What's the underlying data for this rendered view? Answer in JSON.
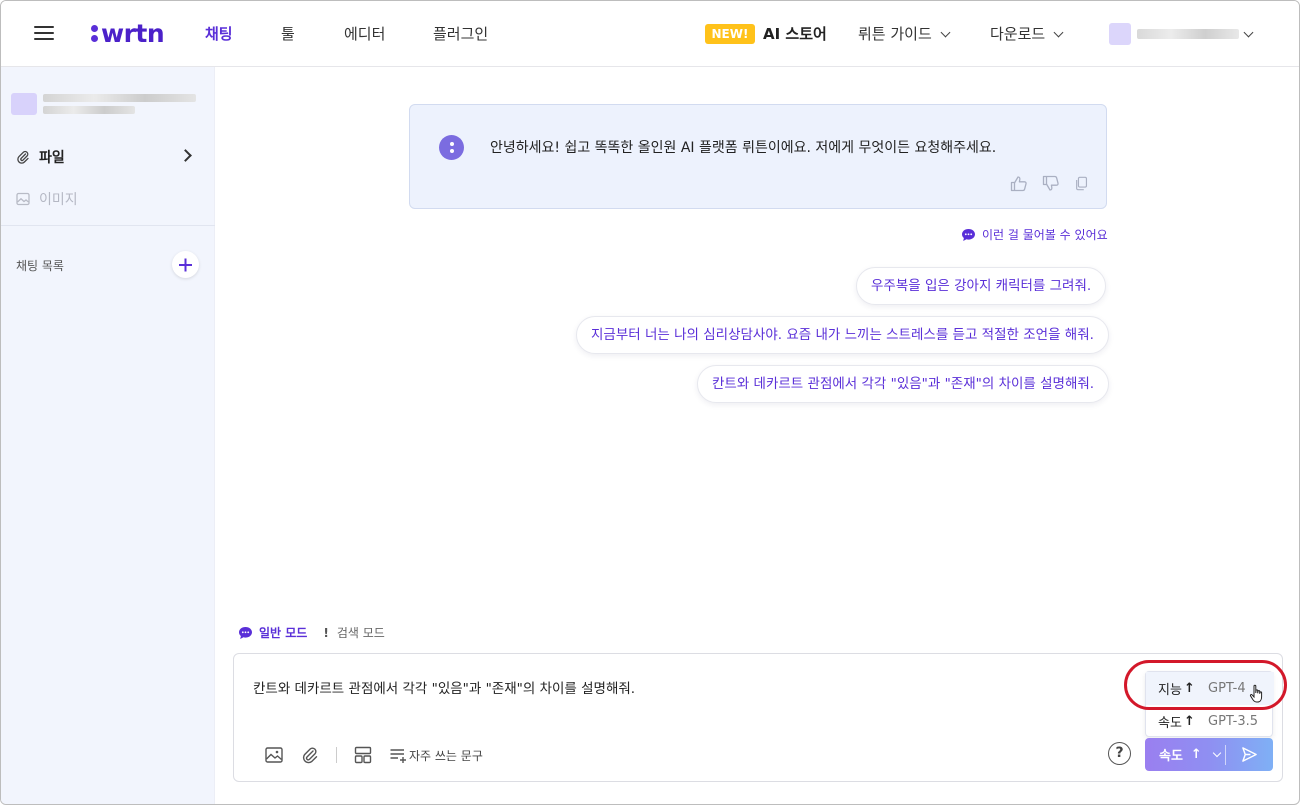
{
  "header": {
    "logo_text": "wrtn",
    "nav": [
      "채팅",
      "툴",
      "에디터",
      "플러그인"
    ],
    "new_badge": "NEW!",
    "store_label": "AI 스토어",
    "guide_label": "뤼튼 가이드",
    "download_label": "다운로드"
  },
  "sidebar": {
    "file_label": "파일",
    "image_label": "이미지",
    "chat_list_label": "채팅 목록"
  },
  "main": {
    "welcome_text": "안녕하세요! 쉽고 똑똑한 올인원 AI 플랫폼 뤼튼이에요. 저에게 무엇이든 요청해주세요.",
    "suggest_title": "이런 걸 물어볼 수 있어요",
    "suggestions": [
      "우주복을 입은 강아지 캐릭터를 그려줘.",
      "지금부터 너는 나의 심리상담사야. 요즘 내가 느끼는 스트레스를 듣고 적절한 조언을 해줘.",
      "칸트와 데카르트 관점에서 각각 \"있음\"과 \"존재\"의 차이를 설명해줘."
    ]
  },
  "input": {
    "mode_normal": "일반 모드",
    "mode_search": "검색 모드",
    "text": "칸트와 데카르트 관점에서 각각 \"있음\"과 \"존재\"의 차이를 설명해줘.",
    "fav_phrase": "자주 쓰는 문구",
    "help": "?",
    "model_options": [
      {
        "key": "지능",
        "arrow": "↑",
        "model": "GPT-4"
      },
      {
        "key": "속도",
        "arrow": "↑",
        "model": "GPT-3.5"
      }
    ],
    "speed_button": "속도",
    "speed_arrow": "↑"
  },
  "colors": {
    "accent": "#5a2fd8",
    "badge": "#ffc21a",
    "highlight": "#d3182a"
  }
}
